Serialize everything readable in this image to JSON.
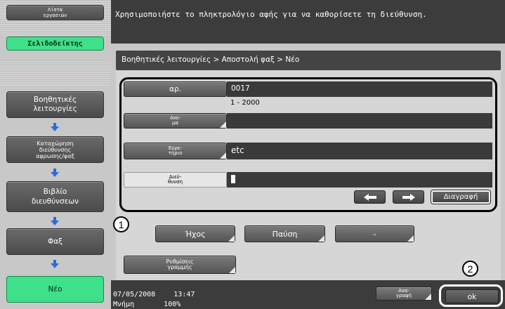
{
  "sidebar": {
    "job_list_line1": "Λίστα",
    "job_list_line2": "εργασιών",
    "bookmark": "Σελιδοδείκτης",
    "util_line1": "Βοηθητικές",
    "util_line2": "λειτουργίες",
    "reg_line1": "Καταχώρηση",
    "reg_line2": "διεύθυνσης",
    "reg_line3": "αφρωσης/φαξ",
    "book_line1": "Βιβλίο",
    "book_line2": "διευθύνσεων",
    "fax": "Φαξ",
    "new": "Νέο"
  },
  "header": {
    "message": "Χρησιμοποιήστε το πληκτρολόγιο αφής για να καθορίσετε τη διεύθυνση."
  },
  "breadcrumb": "Βοηθητικές λειτουργίες > Αποστολή φαξ > Νέο",
  "form": {
    "number_label": "αρ.",
    "number_value": "0017",
    "number_range": "1 - 2000",
    "name_label_1": "όνο-",
    "name_label_2": "μα",
    "name_value": "",
    "index_label_1": "Ευρε-",
    "index_label_2": "τήριο",
    "index_value": "etc",
    "address_label_1": "Διεύ-",
    "address_label_2": "θυνση",
    "address_value": "",
    "delete_label": "Διαγραφή"
  },
  "options": {
    "sound": "Ήχος",
    "pause": "Παύση",
    "dash": "-",
    "line_settings_1": "Ρυθμίσεις",
    "line_settings_2": "γραμμής"
  },
  "callouts": {
    "one": "1",
    "two": "2"
  },
  "footer": {
    "date": "07/05/2008",
    "time": "13:47",
    "memory_label": "Μνήμη",
    "memory_value": "100%",
    "rewrite_1": "Ανα-",
    "rewrite_2": "γραφή",
    "ok": "ok"
  }
}
